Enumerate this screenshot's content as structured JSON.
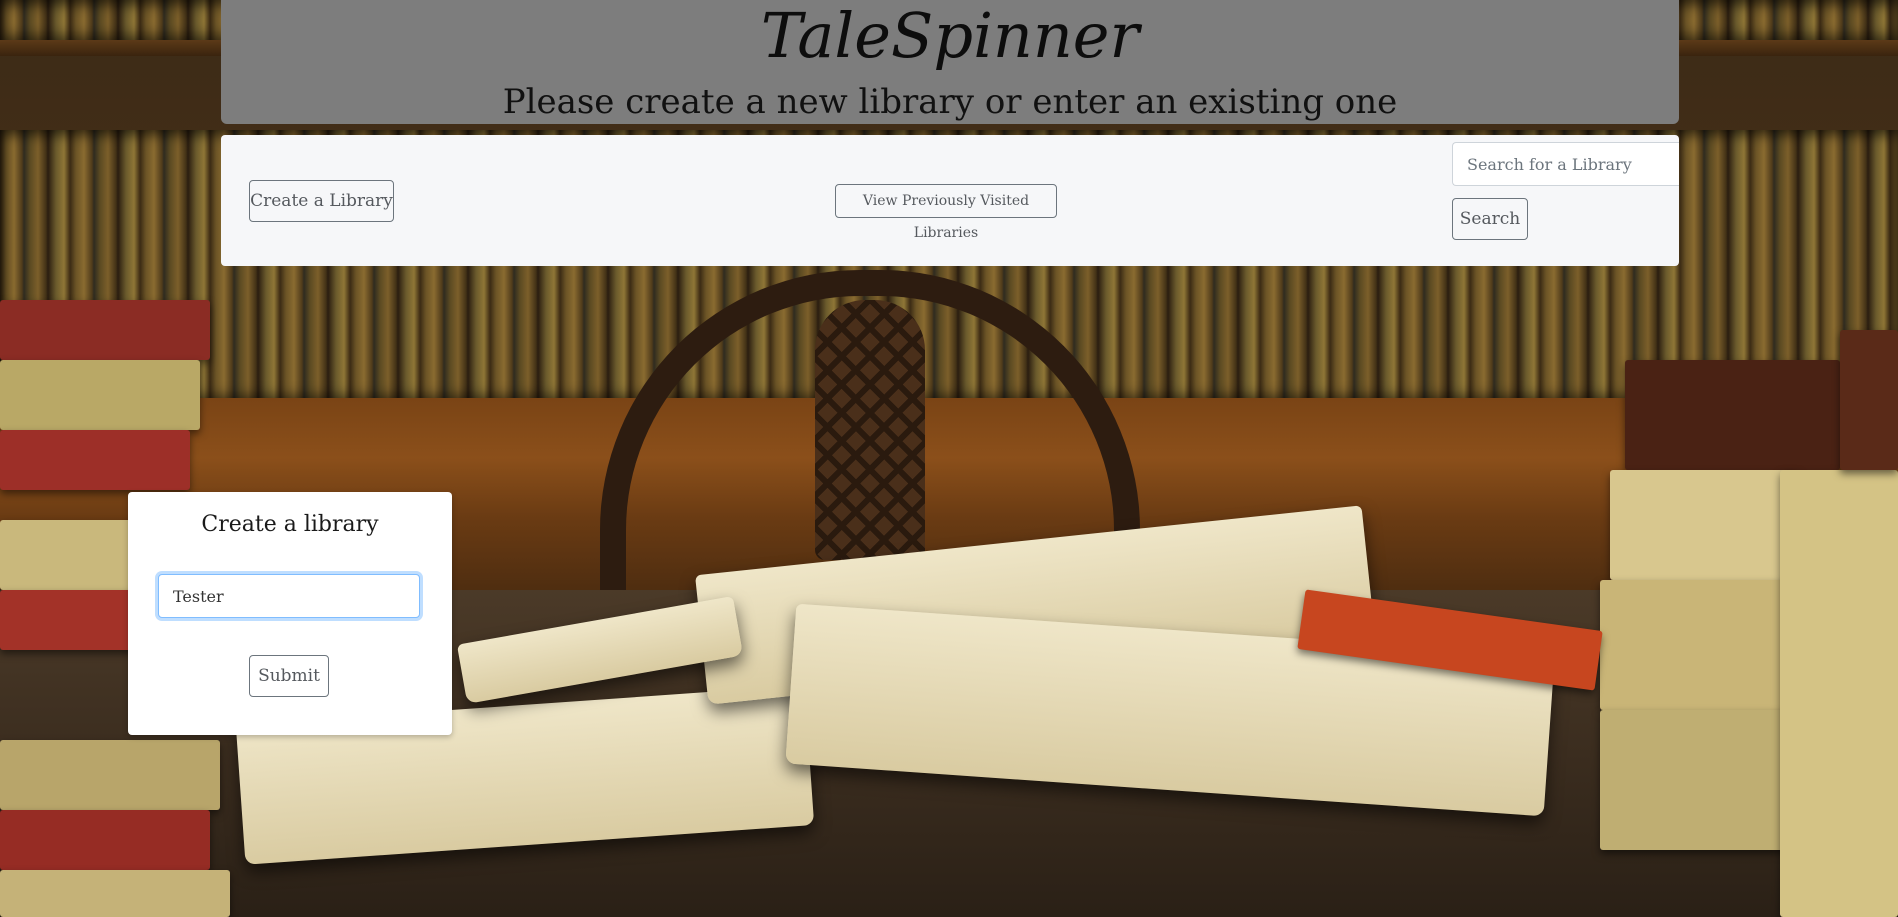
{
  "header": {
    "title": "TaleSpinner",
    "subtitle": "Please create a new library or enter an existing one"
  },
  "navbar": {
    "create_label": "Create a Library",
    "view_previous_label": "View Previously Visited Libraries",
    "search_placeholder": "Search for a Library",
    "search_value": "",
    "search_button_label": "Search"
  },
  "create_card": {
    "title": "Create a library",
    "input_value": "Tester",
    "submit_label": "Submit"
  },
  "colors": {
    "header_bg": "#7d7d7d",
    "navbar_bg": "#f6f7f9",
    "button_border": "#6c757d",
    "focus_border": "#80bdff"
  },
  "background": {
    "icon": "library-bookshelf-scene"
  }
}
